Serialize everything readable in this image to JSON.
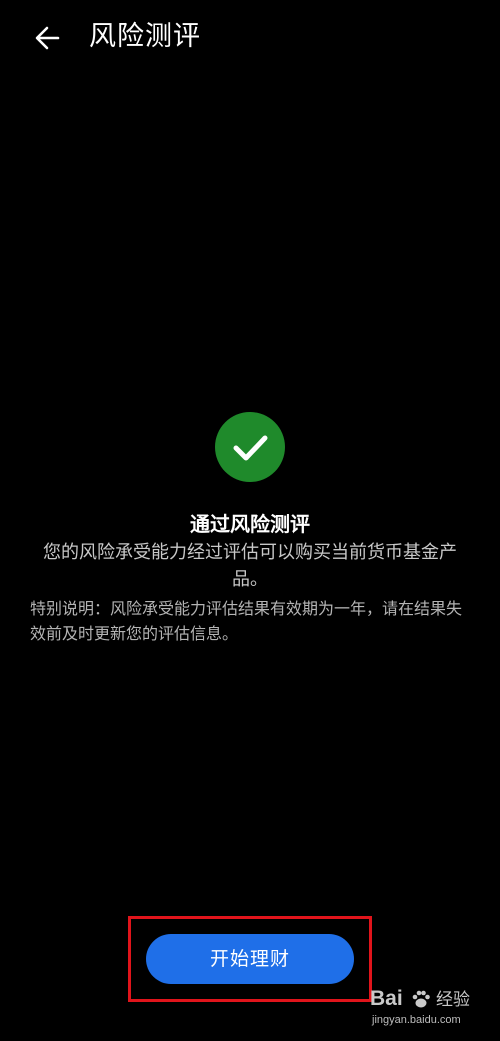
{
  "header": {
    "title": "风险测评",
    "back_icon": "arrow-left-icon"
  },
  "result": {
    "status_icon": "check-circle-icon",
    "status_color": "#1f8a2b",
    "title": "通过风险测评",
    "description": "您的风险承受能力经过评估可以购买当前货币基金产品。",
    "note": "特别说明：风险承受能力评估结果有效期为一年，请在结果失效前及时更新您的评估信息。"
  },
  "actions": {
    "start_button_label": "开始理财",
    "button_color": "#1f6fe8",
    "highlight_color": "#e0141b"
  },
  "watermark": {
    "logo_text": "Bai",
    "logo_suffix": "经验",
    "url": "jingyan.baidu.com"
  }
}
